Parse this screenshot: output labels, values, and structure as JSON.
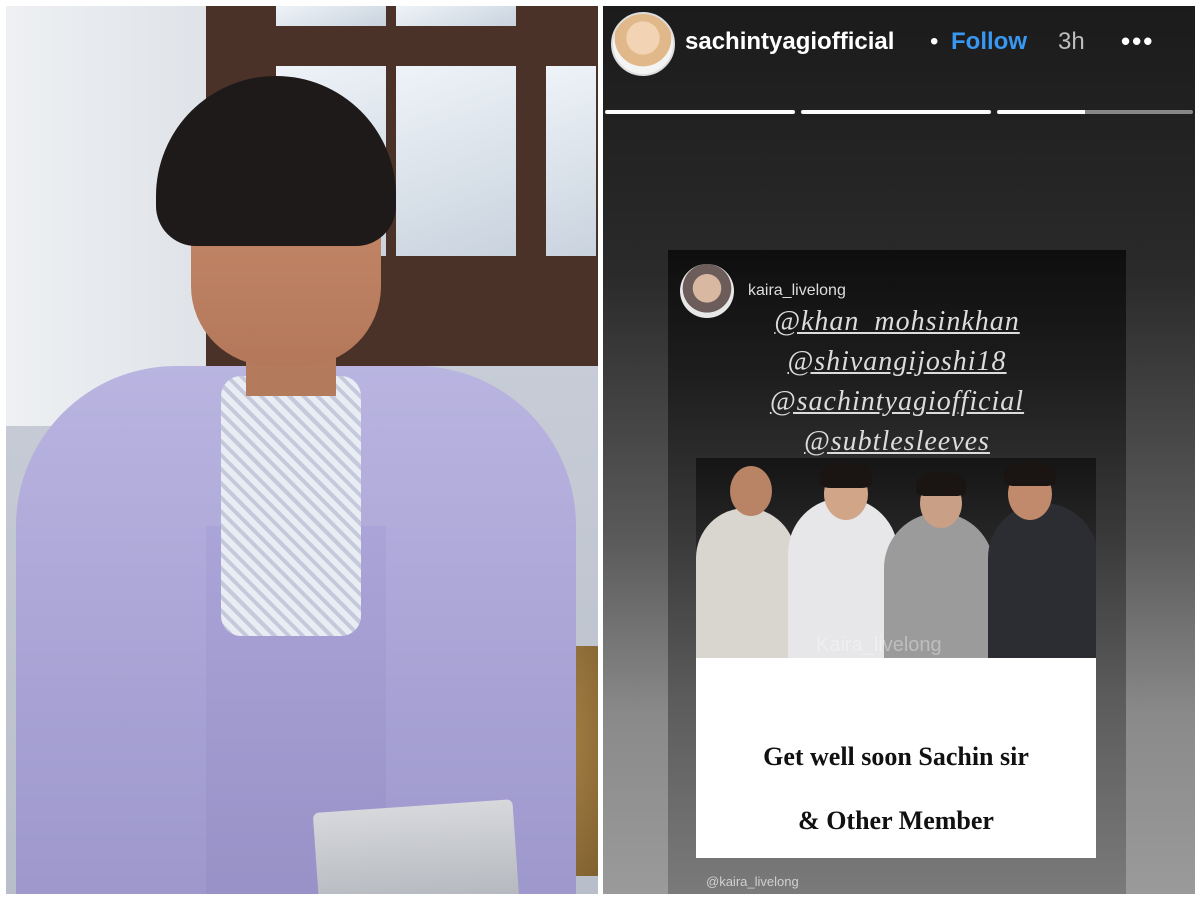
{
  "story": {
    "username": "sachintyagiofficial",
    "separator": "•",
    "follow_label": "Follow",
    "time": "3h",
    "more_label": "•••",
    "progress": [
      1,
      1,
      0.45
    ]
  },
  "post": {
    "username": "kaira_livelong",
    "mentions": [
      "@khan_mohsinkhan",
      "@shivangijoshi18",
      "@sachintyagiofficial",
      "@subtlesleeves"
    ],
    "watermark": "Kaira_livelong",
    "caption_line1": "Get well soon Sachin sir",
    "caption_line2": "& Other Member",
    "credit": "@kaira_livelong"
  },
  "colors": {
    "follow": "#3897f0"
  }
}
